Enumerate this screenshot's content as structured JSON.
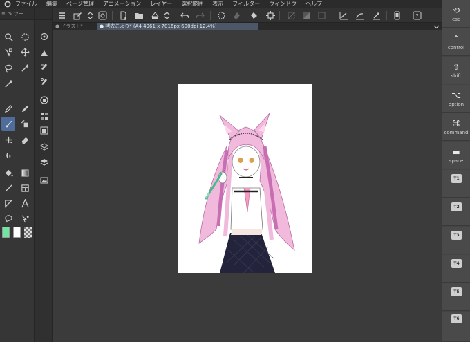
{
  "menu": {
    "items": [
      "ファイル",
      "編集",
      "ページ管理",
      "アニメーション",
      "レイヤー",
      "選択範囲",
      "表示",
      "フィルター",
      "ウィンドウ",
      "ヘルプ"
    ]
  },
  "tool_panel": {
    "header_label": "ツー"
  },
  "tabs": {
    "inactive_label": "イラスト*",
    "active_label": "拷衣こより* (A4 4961 x 7016px 600dpi 12.4%)"
  },
  "colors": {
    "main": "#6ee6a0",
    "sub": "#ffffff",
    "accent_selected": "#4f6c9a",
    "tab_active": "#4c5868"
  },
  "modifier_keys": [
    {
      "icon": "undo-icon",
      "symbol": "⟲",
      "label": "esc"
    },
    {
      "icon": "control-icon",
      "symbol": "⌃",
      "label": "control"
    },
    {
      "icon": "shift-icon",
      "symbol": "⇧",
      "label": "shift"
    },
    {
      "icon": "option-icon",
      "symbol": "⌥",
      "label": "option"
    },
    {
      "icon": "command-icon",
      "symbol": "⌘",
      "label": "command"
    },
    {
      "icon": "space-icon",
      "symbol": "▬",
      "label": "space"
    }
  ],
  "tkeys": [
    "T1",
    "T2",
    "T3",
    "T4",
    "T5",
    "T6"
  ]
}
